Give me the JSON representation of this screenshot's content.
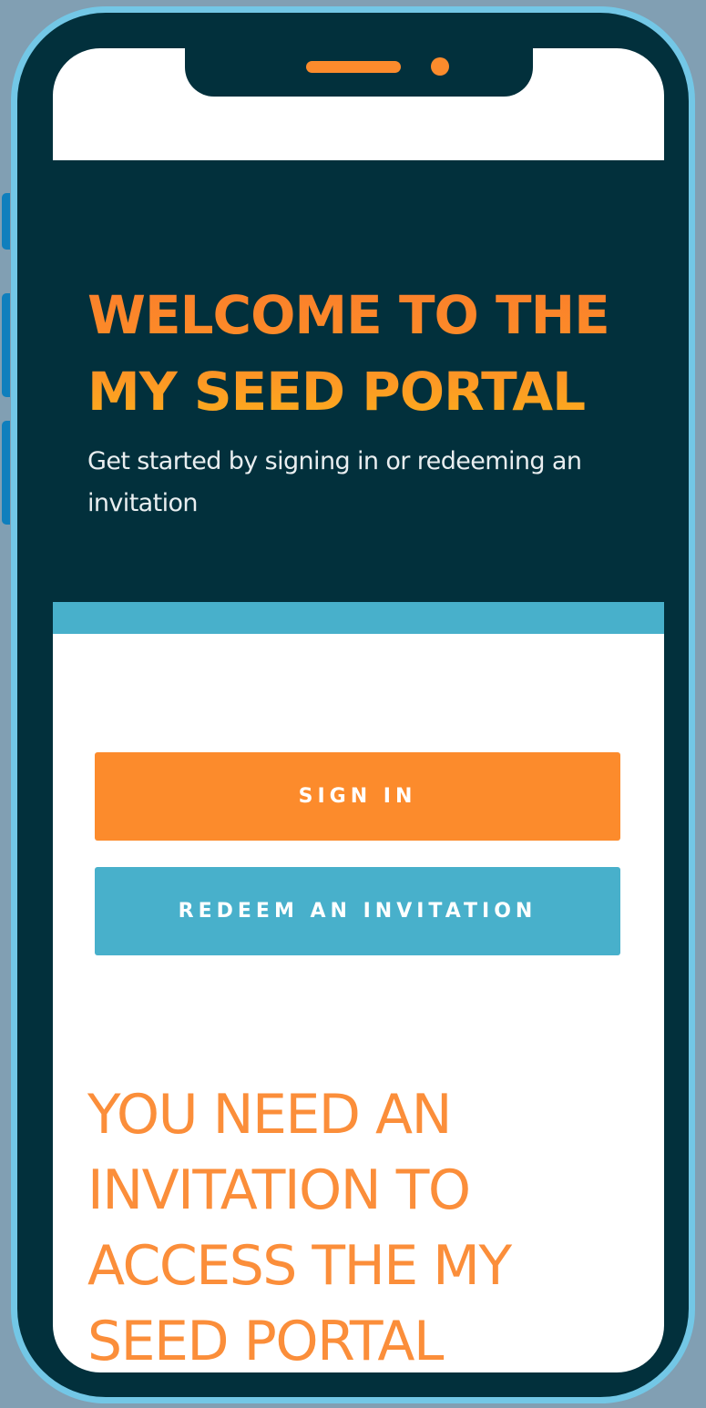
{
  "hero": {
    "title_line1": "WELCOME TO THE",
    "title_line2": "MY SEED PORTAL",
    "subtitle": "Get started by signing in or redeeming an invitation"
  },
  "actions": {
    "sign_in_label": "SIGN IN",
    "redeem_label": "REDEEM AN INVITATION"
  },
  "notice": {
    "line1": "YOU NEED AN",
    "line2": "INVITATION TO",
    "line3": "ACCESS THE MY",
    "line4": "SEED PORTAL"
  },
  "colors": {
    "brand_dark": "#02303c",
    "accent_orange": "#fc8b2c",
    "accent_blue": "#48b0cb",
    "phone_frame": "#73c7e6"
  }
}
